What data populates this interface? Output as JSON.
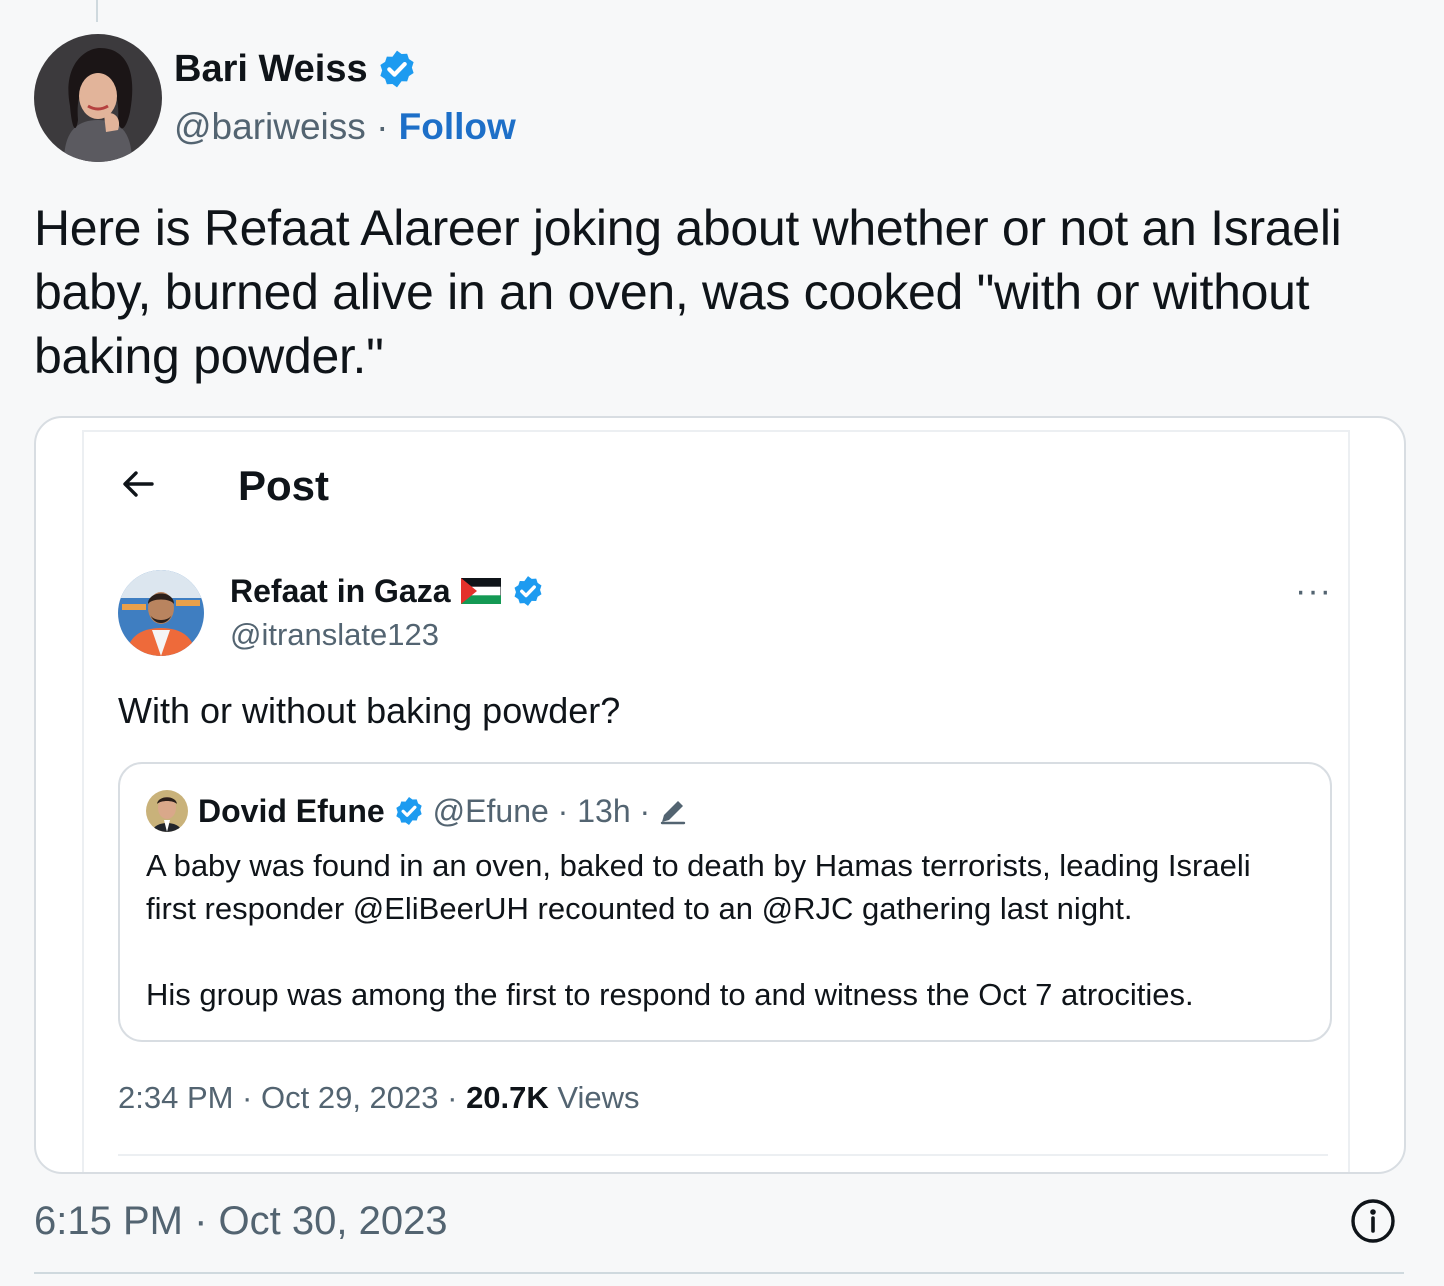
{
  "tweet": {
    "author": {
      "name": "Bari Weiss",
      "handle": "@bariweiss",
      "separator": "·",
      "follow_label": "Follow"
    },
    "text": "Here is Refaat Alareer joking about whether or not an Israeli baby, burned alive in an oven, was cooked \"with or without baking powder.\"",
    "timestamp": "6:15 PM · Oct 30, 2023"
  },
  "embed": {
    "header_title": "Post",
    "author": {
      "name": "Refaat in Gaza",
      "handle": "@itranslate123"
    },
    "text": "With or without baking powder?",
    "quote": {
      "name": "Dovid Efune",
      "handle_time": "@Efune · 13h ·",
      "paragraph1": "A baby was found in an oven, baked to death by Hamas terrorists, leading Israeli first responder @EliBeerUH recounted to an @RJC gathering last night.",
      "paragraph2": "His group was among the first to respond to and witness the Oct 7 atrocities."
    },
    "meta": {
      "time_date": "2:34 PM · Oct 29, 2023 · ",
      "views_count": "20.7K",
      "views_label": " Views"
    },
    "more_label": "···"
  },
  "colors": {
    "link_blue": "#1d6fc8",
    "verified_blue": "#1d9bf0",
    "muted_text": "#536471",
    "border": "#d8dde2"
  },
  "icons": {
    "verified": "verified-badge-icon",
    "back": "arrow-left-icon",
    "more": "more-dots-icon",
    "edit": "pencil-icon",
    "info": "info-icon",
    "flag": "palestine-flag-icon"
  }
}
